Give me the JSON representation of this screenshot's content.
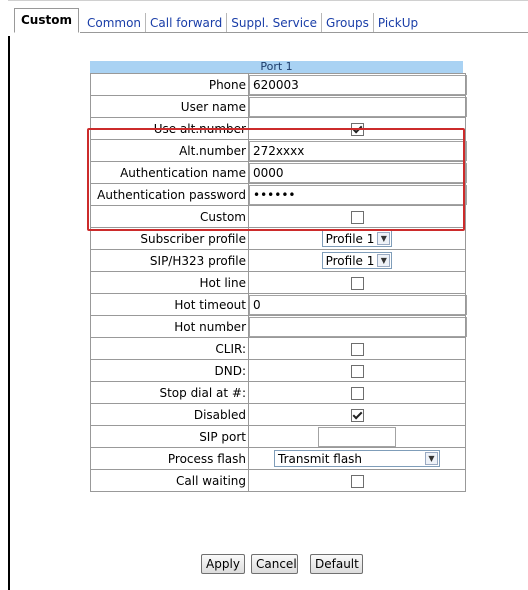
{
  "tabs": [
    "Custom",
    "Common",
    "Call forward",
    "Suppl. Service",
    "Groups",
    "PickUp"
  ],
  "port_title": "Port 1",
  "fields": {
    "phone": {
      "label": "Phone",
      "value": "620003"
    },
    "user_name": {
      "label": "User name",
      "value": ""
    },
    "use_alt_number": {
      "label": "Use alt.number",
      "checked": true
    },
    "alt_number": {
      "label": "Alt.number",
      "value": "272xxxx"
    },
    "auth_name": {
      "label": "Authentication name",
      "value": "0000"
    },
    "auth_password": {
      "label": "Authentication password",
      "value": "••••••"
    },
    "custom": {
      "label": "Custom",
      "checked": false
    },
    "subscriber_profile": {
      "label": "Subscriber profile",
      "value": "Profile 1"
    },
    "sip_h323_profile": {
      "label": "SIP/H323 profile",
      "value": "Profile 1"
    },
    "hot_line": {
      "label": "Hot line",
      "checked": false
    },
    "hot_timeout": {
      "label": "Hot timeout",
      "value": "0"
    },
    "hot_number": {
      "label": "Hot number",
      "value": ""
    },
    "clir": {
      "label": "CLIR:",
      "checked": false
    },
    "dnd": {
      "label": "DND:",
      "checked": false
    },
    "stop_dial": {
      "label": "Stop dial at #:",
      "checked": false
    },
    "disabled": {
      "label": "Disabled",
      "checked": true
    },
    "sip_port": {
      "label": "SIP port",
      "value": ""
    },
    "process_flash": {
      "label": "Process flash",
      "value": "Transmit flash"
    },
    "call_waiting": {
      "label": "Call waiting",
      "checked": false
    }
  },
  "buttons": {
    "apply": "Apply",
    "cancel": "Cancel",
    "default": "Default"
  }
}
